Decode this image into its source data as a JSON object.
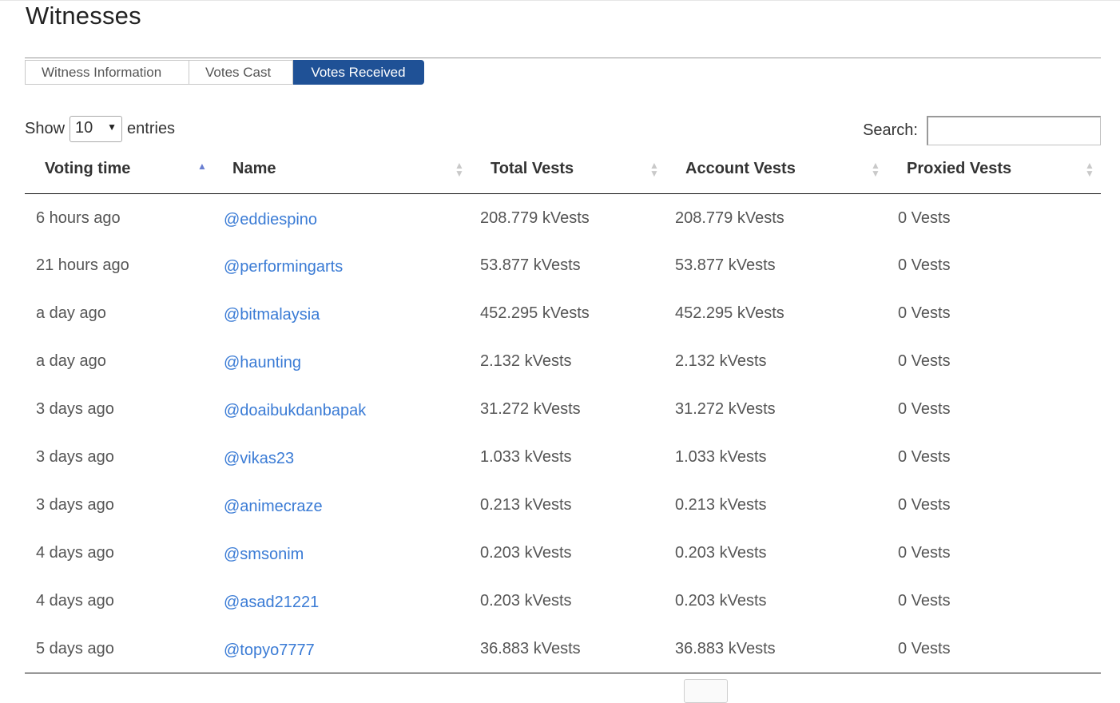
{
  "page": {
    "title": "Witnesses"
  },
  "tabs": [
    {
      "label": "Witness Information",
      "active": false
    },
    {
      "label": "Votes Cast",
      "active": false
    },
    {
      "label": "Votes Received",
      "active": true
    }
  ],
  "length": {
    "show_label": "Show",
    "value": "10",
    "entries_label": "entries"
  },
  "search": {
    "label": "Search:",
    "value": ""
  },
  "table": {
    "columns": [
      {
        "label": "Voting time",
        "sort": "ascending"
      },
      {
        "label": "Name",
        "sort": "none"
      },
      {
        "label": "Total Vests",
        "sort": "none"
      },
      {
        "label": "Account Vests",
        "sort": "none"
      },
      {
        "label": "Proxied Vests",
        "sort": "none"
      }
    ],
    "rows": [
      [
        "6 hours ago",
        "@eddiespino",
        "208.779 kVests",
        "208.779 kVests",
        "0 Vests"
      ],
      [
        "21 hours ago",
        "@performingarts",
        "53.877 kVests",
        "53.877 kVests",
        "0 Vests"
      ],
      [
        "a day ago",
        "@bitmalaysia",
        "452.295 kVests",
        "452.295 kVests",
        "0 Vests"
      ],
      [
        "a day ago",
        "@haunting",
        "2.132 kVests",
        "2.132 kVests",
        "0 Vests"
      ],
      [
        "3 days ago",
        "@doaibukdanbapak",
        "31.272 kVests",
        "31.272 kVests",
        "0 Vests"
      ],
      [
        "3 days ago",
        "@vikas23",
        "1.033 kVests",
        "1.033 kVests",
        "0 Vests"
      ],
      [
        "3 days ago",
        "@animecraze",
        "0.213 kVests",
        "0.213 kVests",
        "0 Vests"
      ],
      [
        "4 days ago",
        "@smsonim",
        "0.203 kVests",
        "0.203 kVests",
        "0 Vests"
      ],
      [
        "4 days ago",
        "@asad21221",
        "0.203 kVests",
        "0.203 kVests",
        "0 Vests"
      ],
      [
        "5 days ago",
        "@topyo7777",
        "36.883 kVests",
        "36.883 kVests",
        "0 Vests"
      ]
    ]
  },
  "colors": {
    "active_tab": "#1f5196",
    "link": "#3a7bd5",
    "sort_active": "#6a7fd1"
  }
}
